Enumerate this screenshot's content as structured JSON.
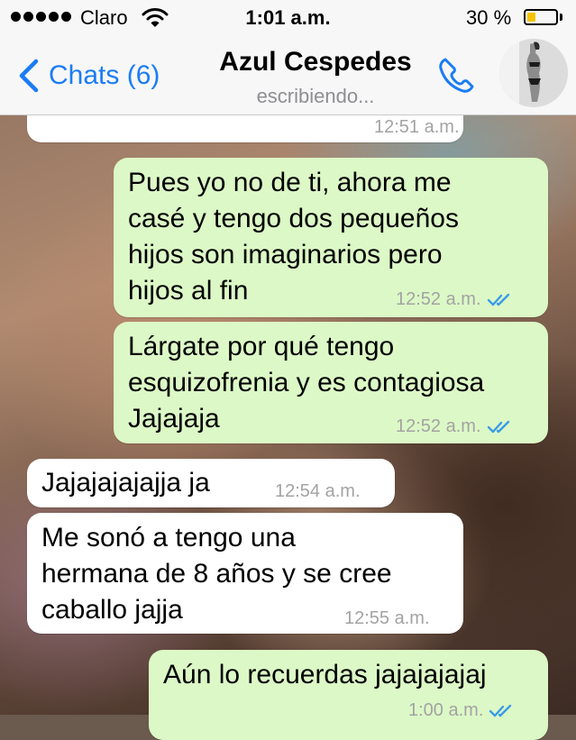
{
  "status_bar": {
    "carrier": "Claro",
    "time": "1:01 a.m.",
    "battery_pct": "30 %",
    "battery_level": 0.3
  },
  "header": {
    "back_label": "Chats (6)",
    "contact_name": "Azul Cespedes",
    "contact_status": "escribiendo..."
  },
  "messages": [
    {
      "side": "in",
      "text": "",
      "time": "12:51 a.m."
    },
    {
      "side": "out",
      "text": "Pues yo no de ti, ahora me\ncasé y tengo dos pequeños\nhijos son imaginarios pero\nhijos al fin",
      "time": "12:52 a.m."
    },
    {
      "side": "out",
      "text": "Lárgate por qué tengo\nesquizofrenia y es contagiosa\nJajajaja",
      "time": "12:52 a.m."
    },
    {
      "side": "in",
      "text": "Jajajajajajja ja",
      "time": "12:54 a.m."
    },
    {
      "side": "in",
      "text": "Me sonó a tengo una\nhermana de 8 años y se cree\ncaballo jajja",
      "time": "12:55 a.m."
    },
    {
      "side": "out",
      "text": "Aún lo recuerdas jajajajajaj",
      "time": "1:00 a.m."
    }
  ],
  "colors": {
    "accent": "#1a7cf5",
    "outgoing_bubble": "#dcf8c6",
    "incoming_bubble": "#ffffff",
    "read_ticks": "#3b9be8",
    "battery": "#f5c400"
  },
  "icons": {
    "back": "chevron-left-icon",
    "call": "phone-icon",
    "wifi": "wifi-icon",
    "read": "double-check-icon"
  }
}
